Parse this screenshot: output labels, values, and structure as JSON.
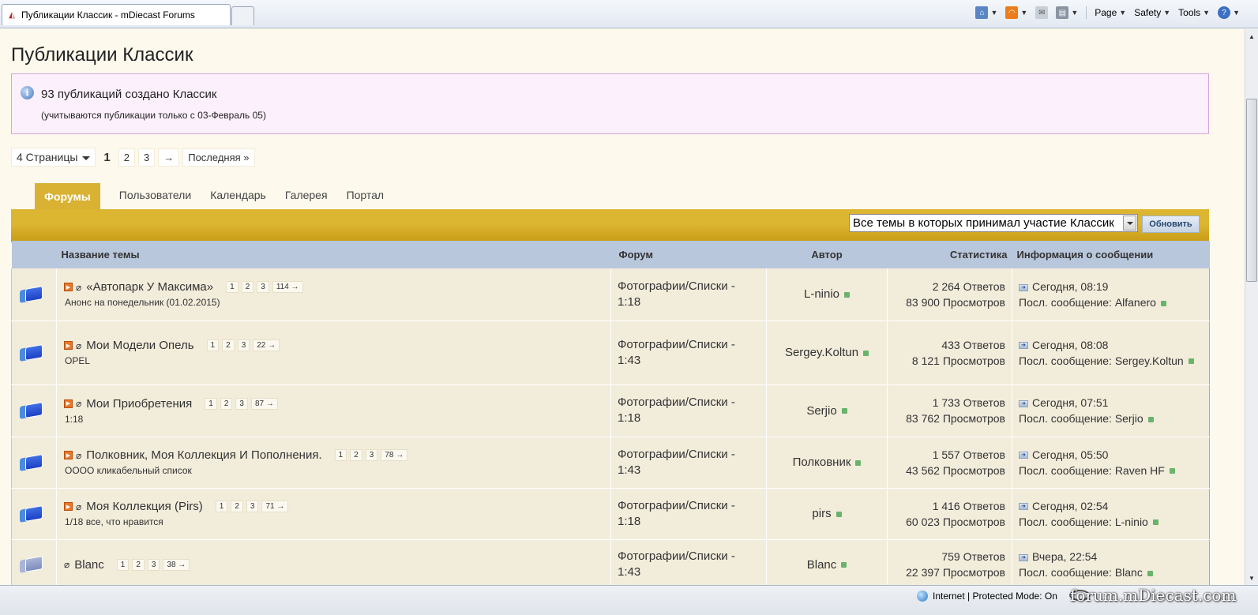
{
  "browser": {
    "tab_title": "Публикации Классик - mDiecast Forums",
    "commands": {
      "page": "Page",
      "safety": "Safety",
      "tools": "Tools"
    },
    "status_zone": "Internet | Protected Mode: On",
    "watermark": "forum.mDiecast.com"
  },
  "page": {
    "title": "Публикации Классик",
    "info_main": "93 публикаций создано Классик",
    "info_sub": "(учитываются публикации только с 03-Февраль 05)"
  },
  "pager": {
    "pages_label": "4 Страницы",
    "current": "1",
    "p2": "2",
    "p3": "3",
    "next": "→",
    "last": "Последняя »"
  },
  "tabs": {
    "forums": "Форумы",
    "members": "Пользователи",
    "calendar": "Календарь",
    "gallery": "Галерея",
    "portal": "Портал"
  },
  "filter": {
    "selected": "Все темы в которых принимал участие Классик",
    "refresh": "Обновить"
  },
  "columns": {
    "title": "Название темы",
    "forum": "Форум",
    "author": "Автор",
    "stats": "Статистика",
    "info": "Информация о сообщении"
  },
  "rows": [
    {
      "title": "«Автопарк У Максима»",
      "subtitle": "Анонс на понедельник (01.02.2015)",
      "pages": [
        "1",
        "2",
        "3",
        "114 →"
      ],
      "forum_a": "Фотографии/Списки -",
      "forum_b": "1:18",
      "author": "L-ninio",
      "replies": "2 264 Ответов",
      "views": "83 900 Просмотров",
      "when": "Сегодня, 08:19",
      "last_label": "Посл. сообщение:",
      "last_user": "Alfanero",
      "file_icon": true
    },
    {
      "title": "Мои Модели Опель",
      "subtitle": "OPEL",
      "pages": [
        "1",
        "2",
        "3",
        "22 →"
      ],
      "forum_a": "Фотографии/Списки -",
      "forum_b": "1:43",
      "author": "Sergey.Koltun",
      "replies": "433 Ответов",
      "views": "8 121 Просмотров",
      "when": "Сегодня, 08:08",
      "last_label": "Посл. сообщение:",
      "last_user": "Sergey.Koltun",
      "file_icon": true
    },
    {
      "title": "Мои Приобретения",
      "subtitle": "1:18",
      "pages": [
        "1",
        "2",
        "3",
        "87 →"
      ],
      "forum_a": "Фотографии/Списки -",
      "forum_b": "1:18",
      "author": "Serjio",
      "replies": "1 733 Ответов",
      "views": "83 762 Просмотров",
      "when": "Сегодня, 07:51",
      "last_label": "Посл. сообщение:",
      "last_user": "Serjio",
      "file_icon": true
    },
    {
      "title": "Полковник, Моя Коллекция И Пополнения.",
      "subtitle": "ОООО кликабельный список",
      "pages": [
        "1",
        "2",
        "3",
        "78 →"
      ],
      "forum_a": "Фотографии/Списки -",
      "forum_b": "1:43",
      "author": "Полковник",
      "replies": "1 557 Ответов",
      "views": "43 562 Просмотров",
      "when": "Сегодня, 05:50",
      "last_label": "Посл. сообщение:",
      "last_user": "Raven HF",
      "file_icon": true
    },
    {
      "title": "Моя Коллекция (Pirs)",
      "subtitle": "1/18 все, что нравится",
      "pages": [
        "1",
        "2",
        "3",
        "71 →"
      ],
      "forum_a": "Фотографии/Списки -",
      "forum_b": "1:18",
      "author": "pirs",
      "replies": "1 416 Ответов",
      "views": "60 023 Просмотров",
      "when": "Сегодня, 02:54",
      "last_label": "Посл. сообщение:",
      "last_user": "L-ninio",
      "file_icon": true
    },
    {
      "title": "Blanc",
      "subtitle": "",
      "pages": [
        "1",
        "2",
        "3",
        "38 →"
      ],
      "forum_a": "Фотографии/Списки -",
      "forum_b": "1:43",
      "author": "Blanc",
      "replies": "759 Ответов",
      "views": "22 397 Просмотров",
      "when": "Вчера, 22:54",
      "last_label": "Посл. сообщение:",
      "last_user": "Blanc",
      "file_icon": false
    }
  ]
}
